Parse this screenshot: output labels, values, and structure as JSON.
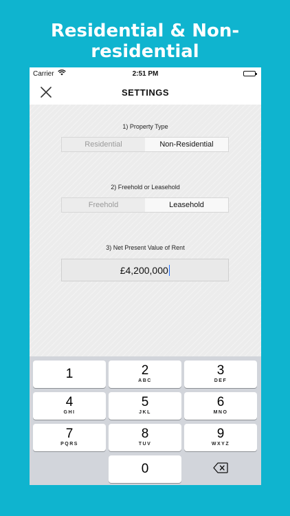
{
  "banner": {
    "title": "Residential & Non-residential"
  },
  "status": {
    "carrier": "Carrier",
    "time": "2:51 PM"
  },
  "nav": {
    "title": "SETTINGS"
  },
  "form": {
    "property_type": {
      "label": "1) Property Type",
      "options": [
        "Residential",
        "Non-Residential"
      ],
      "selected": "Non-Residential"
    },
    "tenure": {
      "label": "2) Freehold or Leasehold",
      "options": [
        "Freehold",
        "Leasehold"
      ],
      "selected": "Leasehold"
    },
    "npv": {
      "label": "3) Net Present Value of Rent",
      "value": "£4,200,000"
    }
  },
  "keyboard": {
    "keys": [
      {
        "digit": "1",
        "letters": ""
      },
      {
        "digit": "2",
        "letters": "ABC"
      },
      {
        "digit": "3",
        "letters": "DEF"
      },
      {
        "digit": "4",
        "letters": "GHI"
      },
      {
        "digit": "5",
        "letters": "JKL"
      },
      {
        "digit": "6",
        "letters": "MNO"
      },
      {
        "digit": "7",
        "letters": "PQRS"
      },
      {
        "digit": "8",
        "letters": "TUV"
      },
      {
        "digit": "9",
        "letters": "WXYZ"
      },
      {
        "digit": "0",
        "letters": ""
      }
    ]
  }
}
